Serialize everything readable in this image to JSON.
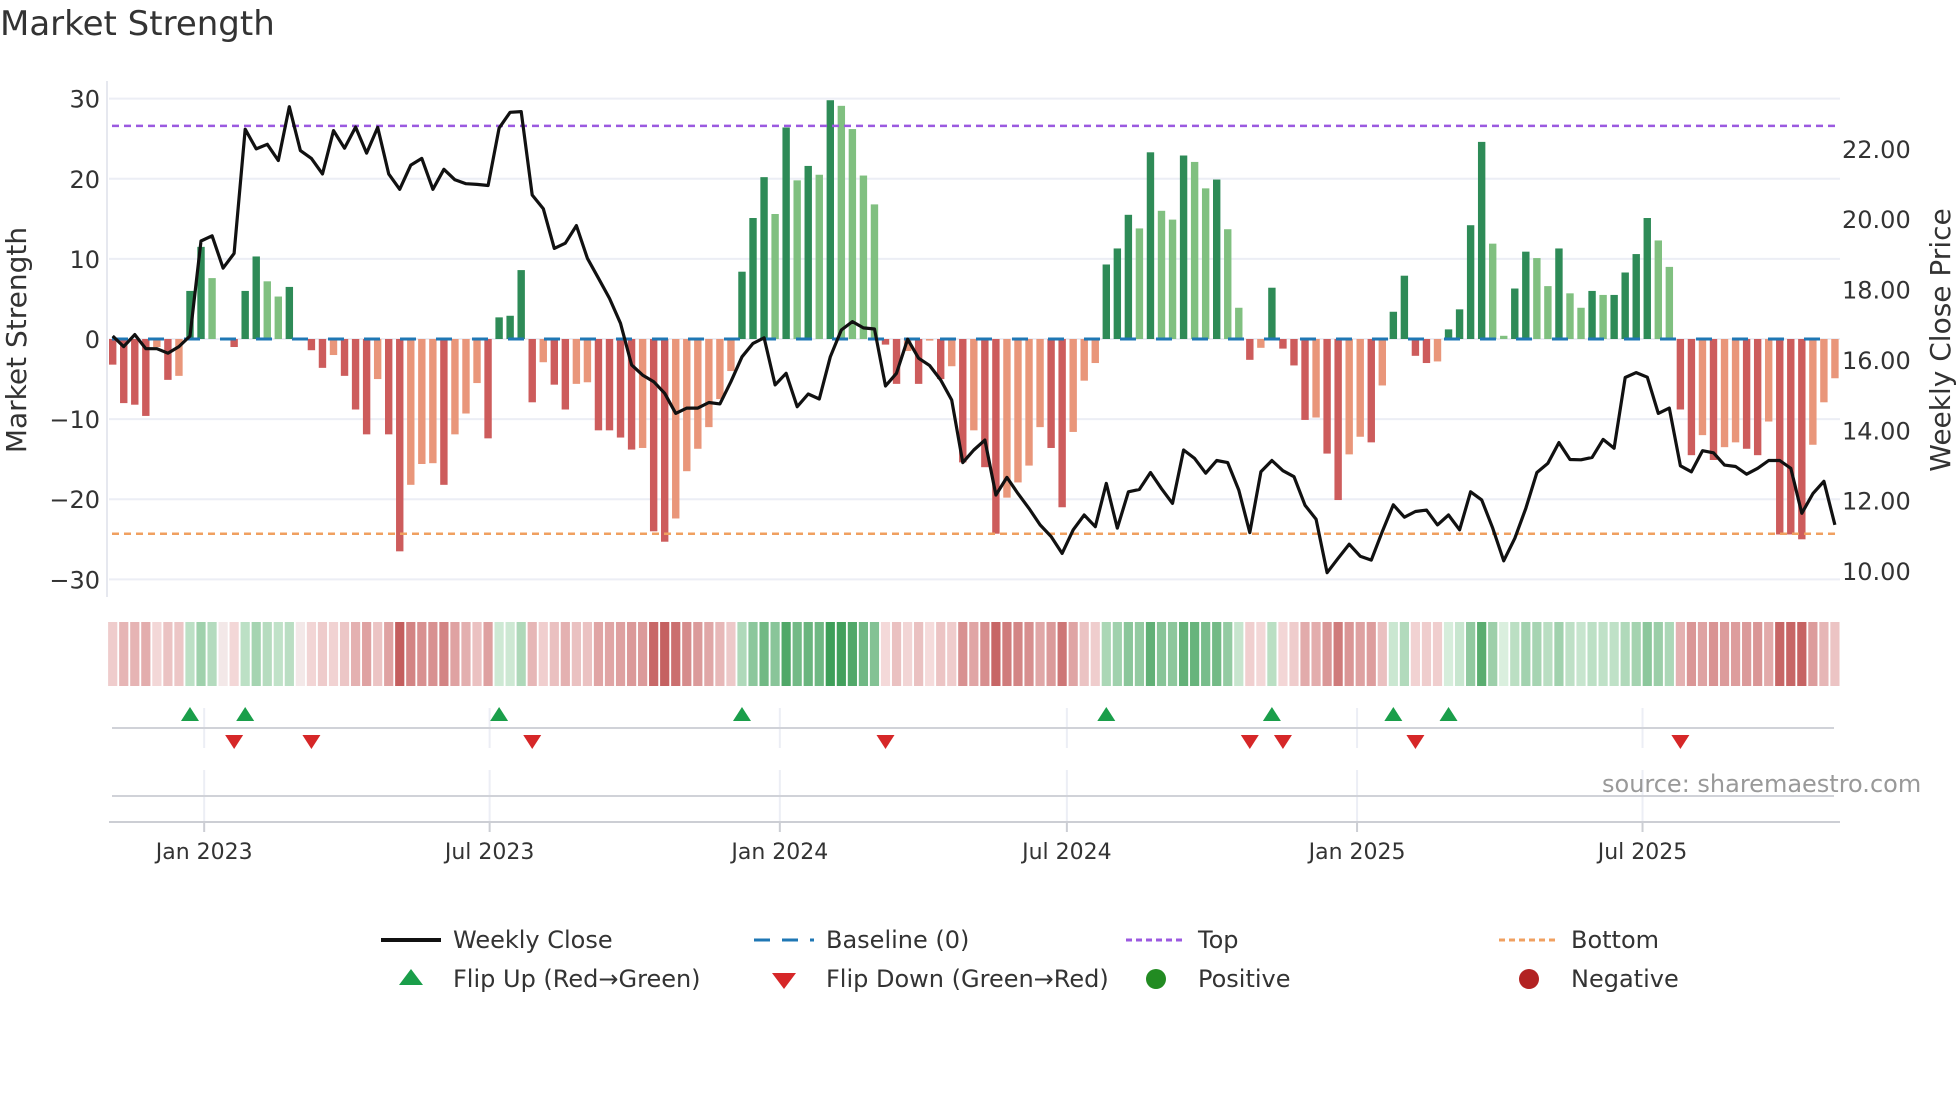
{
  "chart_data": {
    "type": "bar",
    "title": "Market Strength",
    "ylabel": "Market Strength",
    "y2label": "Weekly Close Price",
    "ylim": [
      -32.2,
      32.2
    ],
    "y2lim": [
      9.26,
      23.93
    ],
    "yticks": [
      30,
      20,
      10,
      0,
      -10,
      -20,
      -30
    ],
    "yticklabels": [
      "30",
      "20",
      "10",
      "0",
      "−10",
      "−20",
      "−30"
    ],
    "y2ticks": [
      22,
      20,
      18,
      16,
      14,
      12,
      10
    ],
    "y2ticklabels": [
      "22.00",
      "20.00",
      "18.00",
      "16.00",
      "14.00",
      "12.00",
      "10.00"
    ],
    "x_start": "2022-11-04",
    "x_interval_days": 7,
    "xticks": [
      {
        "label": "Jan 2023",
        "date": "2023-01-01"
      },
      {
        "label": "Jul 2023",
        "date": "2023-07-01"
      },
      {
        "label": "Jan 2024",
        "date": "2024-01-01"
      },
      {
        "label": "Jul 2024",
        "date": "2024-07-01"
      },
      {
        "label": "Jan 2025",
        "date": "2025-01-01"
      },
      {
        "label": "Jul 2025",
        "date": "2025-07-01"
      }
    ],
    "top_level": 26.6,
    "bottom_level": -24.3,
    "baseline": 0,
    "strength": [
      -3.2,
      -8.0,
      -8.2,
      -9.6,
      -1.0,
      -5.1,
      -4.6,
      6.0,
      11.5,
      7.6,
      0,
      -1.0,
      6.0,
      10.3,
      7.2,
      5.3,
      6.5,
      0,
      -1.4,
      -3.6,
      -2.0,
      -4.6,
      -8.8,
      -11.9,
      -5.0,
      -11.9,
      -26.5,
      -18.2,
      -15.6,
      -15.5,
      -18.2,
      -11.9,
      -9.3,
      -5.5,
      -12.4,
      2.7,
      2.9,
      8.6,
      -7.9,
      -2.9,
      -5.7,
      -8.8,
      -5.6,
      -5.4,
      -11.4,
      -11.4,
      -12.3,
      -13.8,
      -13.6,
      -24.0,
      -25.3,
      -22.4,
      -16.5,
      -13.7,
      -11.0,
      -7.5,
      -4.0,
      8.4,
      15.1,
      20.2,
      15.6,
      26.4,
      19.8,
      21.6,
      20.5,
      29.8,
      29.1,
      26.2,
      20.4,
      16.8,
      -0.7,
      -5.6,
      -1.5,
      -5.6,
      -0.2,
      -5.0,
      -3.4,
      -15.4,
      -11.4,
      -16.0,
      -24.3,
      -19.8,
      -17.9,
      -15.8,
      -11.0,
      -13.6,
      -21.0,
      -11.6,
      -5.2,
      -3.0,
      9.3,
      11.3,
      15.5,
      13.8,
      23.3,
      16.0,
      14.9,
      22.9,
      22.1,
      18.8,
      19.9,
      13.7,
      3.9,
      -2.6,
      -1.1,
      6.4,
      -1.2,
      -3.3,
      -10.1,
      -9.8,
      -14.3,
      -20.1,
      -14.4,
      -12.2,
      -12.9,
      -5.8,
      3.4,
      7.9,
      -2.1,
      -3.0,
      -2.8,
      1.2,
      3.7,
      14.2,
      24.6,
      11.9,
      0.4,
      6.3,
      10.9,
      10.1,
      6.6,
      11.3,
      5.7,
      3.9,
      6.0,
      5.5,
      5.5,
      8.3,
      10.6,
      15.1,
      12.3,
      9.0,
      -8.8,
      -14.5,
      -12.0,
      -15.1,
      -13.5,
      -12.9,
      -13.7,
      -14.5,
      -10.3,
      -24.4,
      -24.4,
      -25.0,
      -13.2,
      -7.9,
      -4.9
    ],
    "weekly_close": [
      16.68,
      16.38,
      16.72,
      16.32,
      16.32,
      16.19,
      16.38,
      16.68,
      19.38,
      19.53,
      18.61,
      19.03,
      22.56,
      22.0,
      22.13,
      21.67,
      23.2,
      21.95,
      21.73,
      21.29,
      22.52,
      22.02,
      22.62,
      21.88,
      22.61,
      21.29,
      20.85,
      21.54,
      21.73,
      20.85,
      21.42,
      21.12,
      21.01,
      20.99,
      20.96,
      22.59,
      23.04,
      23.06,
      20.69,
      20.3,
      19.17,
      19.32,
      19.82,
      18.89,
      18.32,
      17.75,
      17.04,
      15.86,
      15.57,
      15.38,
      15.05,
      14.48,
      14.63,
      14.63,
      14.79,
      14.75,
      15.38,
      16.09,
      16.47,
      16.63,
      15.29,
      15.62,
      14.67,
      15.03,
      14.89,
      16.09,
      16.85,
      17.09,
      16.91,
      16.88,
      15.26,
      15.62,
      16.59,
      16.05,
      15.84,
      15.43,
      14.86,
      13.08,
      13.44,
      13.72,
      12.16,
      12.66,
      12.2,
      11.78,
      11.31,
      10.98,
      10.5,
      11.17,
      11.59,
      11.26,
      12.49,
      11.22,
      12.25,
      12.32,
      12.8,
      12.34,
      11.92,
      13.44,
      13.2,
      12.78,
      13.14,
      13.08,
      12.3,
      11.09,
      12.82,
      13.14,
      12.85,
      12.68,
      11.87,
      11.47,
      9.95,
      10.36,
      10.76,
      10.42,
      10.31,
      11.12,
      11.88,
      11.53,
      11.69,
      11.73,
      11.31,
      11.59,
      11.17,
      12.25,
      12.02,
      11.22,
      10.29,
      10.93,
      11.78,
      12.8,
      13.06,
      13.65,
      13.17,
      13.16,
      13.23,
      13.74,
      13.49,
      15.5,
      15.64,
      15.51,
      14.48,
      14.63,
      12.99,
      12.82,
      13.42,
      13.36,
      13.01,
      12.97,
      12.75,
      12.92,
      13.14,
      13.14,
      12.92,
      11.64,
      12.2,
      12.55,
      11.31
    ],
    "flip_up": [
      7,
      12,
      35,
      57,
      90,
      105,
      116,
      121
    ],
    "flip_down": [
      11,
      18,
      38,
      70,
      103,
      106,
      118,
      142
    ],
    "colors": {
      "pos_strong": "#2e8b57",
      "pos_weak": "#80c080",
      "neg_strong": "#cd5c5c",
      "neg_weak": "#e9967a",
      "close": "#111111",
      "baseline": "#1f77b4",
      "top": "#9b59e0",
      "bottom": "#f0a060",
      "flip_up": "#1a9e4a",
      "flip_down": "#d62728",
      "positive": "#228b22",
      "negative": "#b22222"
    },
    "legend": {
      "weekly_close": "Weekly Close",
      "baseline": "Baseline (0)",
      "top": "Top",
      "bottom": "Bottom",
      "flip_up": "Flip Up (Red→Green)",
      "flip_down": "Flip Down (Green→Red)",
      "positive": "Positive",
      "negative": "Negative"
    },
    "legend_placement": "bottom",
    "grid": true
  },
  "source": "source: sharemaestro.com"
}
